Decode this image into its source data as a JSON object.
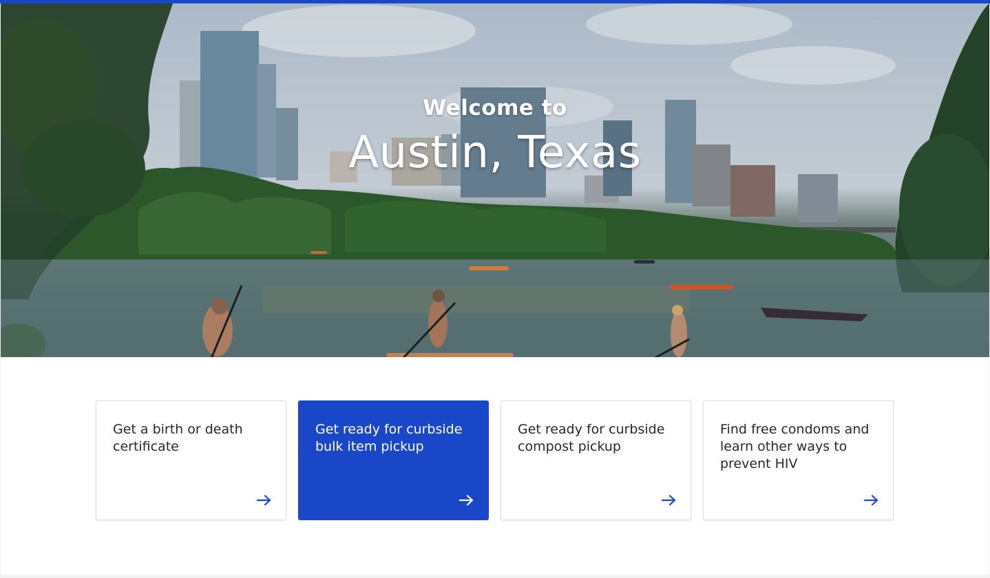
{
  "colors": {
    "brand_blue": "#1a47c8",
    "card_text": "#27282b",
    "card_border": "#dcdde0"
  },
  "hero": {
    "eyebrow": "Welcome to",
    "title": "Austin, Texas",
    "background_icon": "austin-skyline-lake-photo"
  },
  "cards": [
    {
      "label": "Get a birth or death certificate",
      "icon": "arrow-right-icon",
      "active": false
    },
    {
      "label": "Get ready for curbside bulk item pickup",
      "icon": "arrow-right-icon",
      "active": true
    },
    {
      "label": "Get ready for curbside compost pickup",
      "icon": "arrow-right-icon",
      "active": false
    },
    {
      "label": "Find free condoms and learn other ways to prevent HIV",
      "icon": "arrow-right-icon",
      "active": false
    }
  ]
}
